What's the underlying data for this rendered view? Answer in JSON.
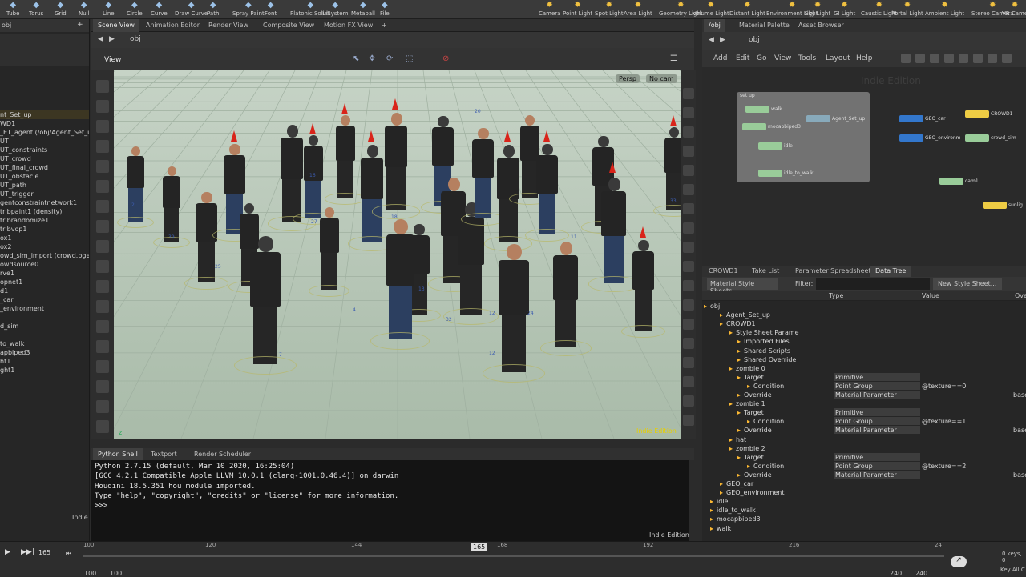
{
  "shelf": {
    "tools": [
      "Tube",
      "Torus",
      "Grid",
      "Null",
      "Line",
      "Circle",
      "Curve",
      "Draw Curve",
      "Path",
      "Spray Paint",
      "Font",
      "Platonic Solids",
      "L-System",
      "Metaball",
      "File"
    ],
    "lights": [
      "Camera",
      "Point Light",
      "Spot Light",
      "Area Light",
      "Geometry Light",
      "Volume Light",
      "Distant Light",
      "Environment Light",
      "Sky Light",
      "GI Light",
      "Caustic Light",
      "Portal Light",
      "Ambient Light",
      "Stereo Camera",
      "VR Came"
    ]
  },
  "left_pane": {
    "path": "obj",
    "items": [
      "nt_Set_up",
      "WD1",
      "_ET_agent (/obj/Agent_Set_up/",
      "UT",
      "UT_constraints",
      "UT_crowd",
      "UT_final_crowd",
      "UT_obstacle",
      "UT_path",
      "UT_trigger",
      "gentconstraintnetwork1",
      "tribpaint1 (density)",
      "tribrandomize1",
      "tribvop1",
      "ox1",
      "ox2",
      "owd_sim_import (crowd.bgeo",
      "owdsource0",
      "rve1",
      "opnet1",
      "d1",
      "_car",
      "_environment",
      "",
      "d_sim",
      "",
      "to_walk",
      "apbiped3",
      "ht1",
      "ght1"
    ],
    "footer": "Indie"
  },
  "scene_view": {
    "tabs": [
      "Scene View",
      "Animation Editor",
      "Render View",
      "Composite View",
      "Motion FX View"
    ],
    "path": "obj",
    "title": "View",
    "persp": "Persp",
    "cam": "No cam",
    "watermark": "Indie Edition",
    "axis": "z",
    "agent_numbers": [
      "2",
      "39",
      "25",
      "27",
      "16",
      "18",
      "20",
      "13",
      "12",
      "4",
      "7",
      "32",
      "12",
      "24",
      "33",
      "11"
    ]
  },
  "console": {
    "tabs": [
      "Python Shell",
      "Textport",
      "Render Scheduler"
    ],
    "lines": [
      "Python 2.7.15 (default, Mar 10 2020, 16:25:04)",
      "[GCC 4.2.1 Compatible Apple LLVM 10.0.1 (clang-1001.0.46.4)] on darwin",
      "Houdini 18.5.351 hou module imported.",
      "Type \"help\", \"copyright\", \"credits\" or \"license\" for more information.",
      ">>>"
    ],
    "watermark": "Indie Edition"
  },
  "network": {
    "tabs": [
      "/obj",
      "Material Palette",
      "Asset Browser"
    ],
    "path": "obj",
    "menu": [
      "Add",
      "Edit",
      "Go",
      "View",
      "Tools",
      "Layout",
      "Help"
    ],
    "watermark": "Indie Edition",
    "group_title": "set up",
    "nodes": [
      "walk",
      "mocapbiped3",
      "Agent_Set_up",
      "idle",
      "idle_to_walk",
      "GEO_car",
      "GEO_environm",
      "CROWD1",
      "crowd_sim",
      "cam1",
      "sunlig"
    ]
  },
  "datatree": {
    "tabs": [
      "CROWD1",
      "Take List",
      "Parameter Spreadsheet",
      "Data Tree"
    ],
    "dropdown": "Material Style Sheets",
    "filter_label": "Filter:",
    "new_button": "New Style Sheet...",
    "columns": [
      "Type",
      "Value",
      "Ove"
    ],
    "rows": [
      {
        "label": "obj",
        "type": "",
        "value": ""
      },
      {
        "label": "Agent_Set_up",
        "type": "",
        "value": ""
      },
      {
        "label": "CROWD1",
        "type": "",
        "value": ""
      },
      {
        "label": "Style Sheet Parame",
        "type": "",
        "value": ""
      },
      {
        "label": "Imported Files",
        "type": "",
        "value": ""
      },
      {
        "label": "Shared Scripts",
        "type": "",
        "value": ""
      },
      {
        "label": "Shared Override",
        "type": "",
        "value": ""
      },
      {
        "label": "zombie 0",
        "type": "",
        "value": ""
      },
      {
        "label": "Target",
        "type": "Primitive",
        "value": ""
      },
      {
        "label": "Condition",
        "type": "Point Group",
        "value": "@texture==0"
      },
      {
        "label": "Override",
        "type": "Material Parameter",
        "value": "base"
      },
      {
        "label": "zombie 1",
        "type": "",
        "value": ""
      },
      {
        "label": "Target",
        "type": "Primitive",
        "value": ""
      },
      {
        "label": "Condition",
        "type": "Point Group",
        "value": "@texture==1"
      },
      {
        "label": "Override",
        "type": "Material Parameter",
        "value": "base"
      },
      {
        "label": "hat",
        "type": "",
        "value": ""
      },
      {
        "label": "zombie 2",
        "type": "",
        "value": ""
      },
      {
        "label": "Target",
        "type": "Primitive",
        "value": ""
      },
      {
        "label": "Condition",
        "type": "Point Group",
        "value": "@texture==2"
      },
      {
        "label": "Override",
        "type": "Material Parameter",
        "value": "base"
      },
      {
        "label": "GEO_car",
        "type": "",
        "value": ""
      },
      {
        "label": "GEO_environment",
        "type": "",
        "value": ""
      },
      {
        "label": "idle",
        "type": "",
        "value": ""
      },
      {
        "label": "idle_to_walk",
        "type": "",
        "value": ""
      },
      {
        "label": "mocapbiped3",
        "type": "",
        "value": ""
      },
      {
        "label": "walk",
        "type": "",
        "value": ""
      }
    ]
  },
  "timeline": {
    "frame": "165",
    "current": "165",
    "ticks": [
      "100",
      "120",
      "144",
      "168",
      "192",
      "216",
      "24"
    ],
    "start": "100",
    "start2": "100",
    "end": "240",
    "end2": "240",
    "keys": "0 keys, 0",
    "keyall": "Key All C"
  }
}
